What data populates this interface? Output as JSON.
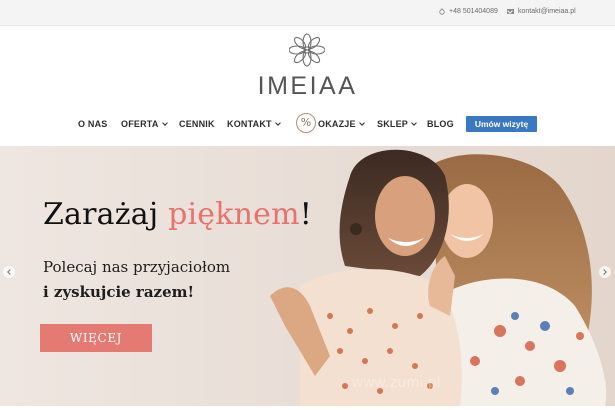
{
  "topbar": {
    "phone": "+48 501404089",
    "email": "kontakt@imeiaa.pl",
    "phone_icon": "phone-icon",
    "email_icon": "envelope-icon"
  },
  "header": {
    "logo_text": "IMEIAA",
    "logo_icon": "lotus-mandala-logo"
  },
  "nav": {
    "items": [
      {
        "label": "O NAS"
      },
      {
        "label": "OFERTA",
        "dropdown": true
      },
      {
        "label": "CENNIK"
      },
      {
        "label": "KONTAKT",
        "dropdown": true
      },
      {
        "label": "OKAZJE",
        "dropdown": true
      },
      {
        "label": "SKLEP",
        "dropdown": true
      },
      {
        "label": "BLOG"
      }
    ],
    "percent_badge": "%",
    "cta_label": "Umów wizytę",
    "cta_color": "#3a78c2"
  },
  "hero": {
    "headline_part1": "Zarażaj ",
    "headline_accent": "pięknem",
    "headline_part2": "!",
    "subline1": "Polecaj nas przyjaciołom",
    "subline2": "i zyskujcie razem!",
    "button_label": "WIĘCEJ",
    "accent_color": "#e6736d",
    "background_color": "#ece3dc",
    "watermark": "www.zumi.pl"
  }
}
